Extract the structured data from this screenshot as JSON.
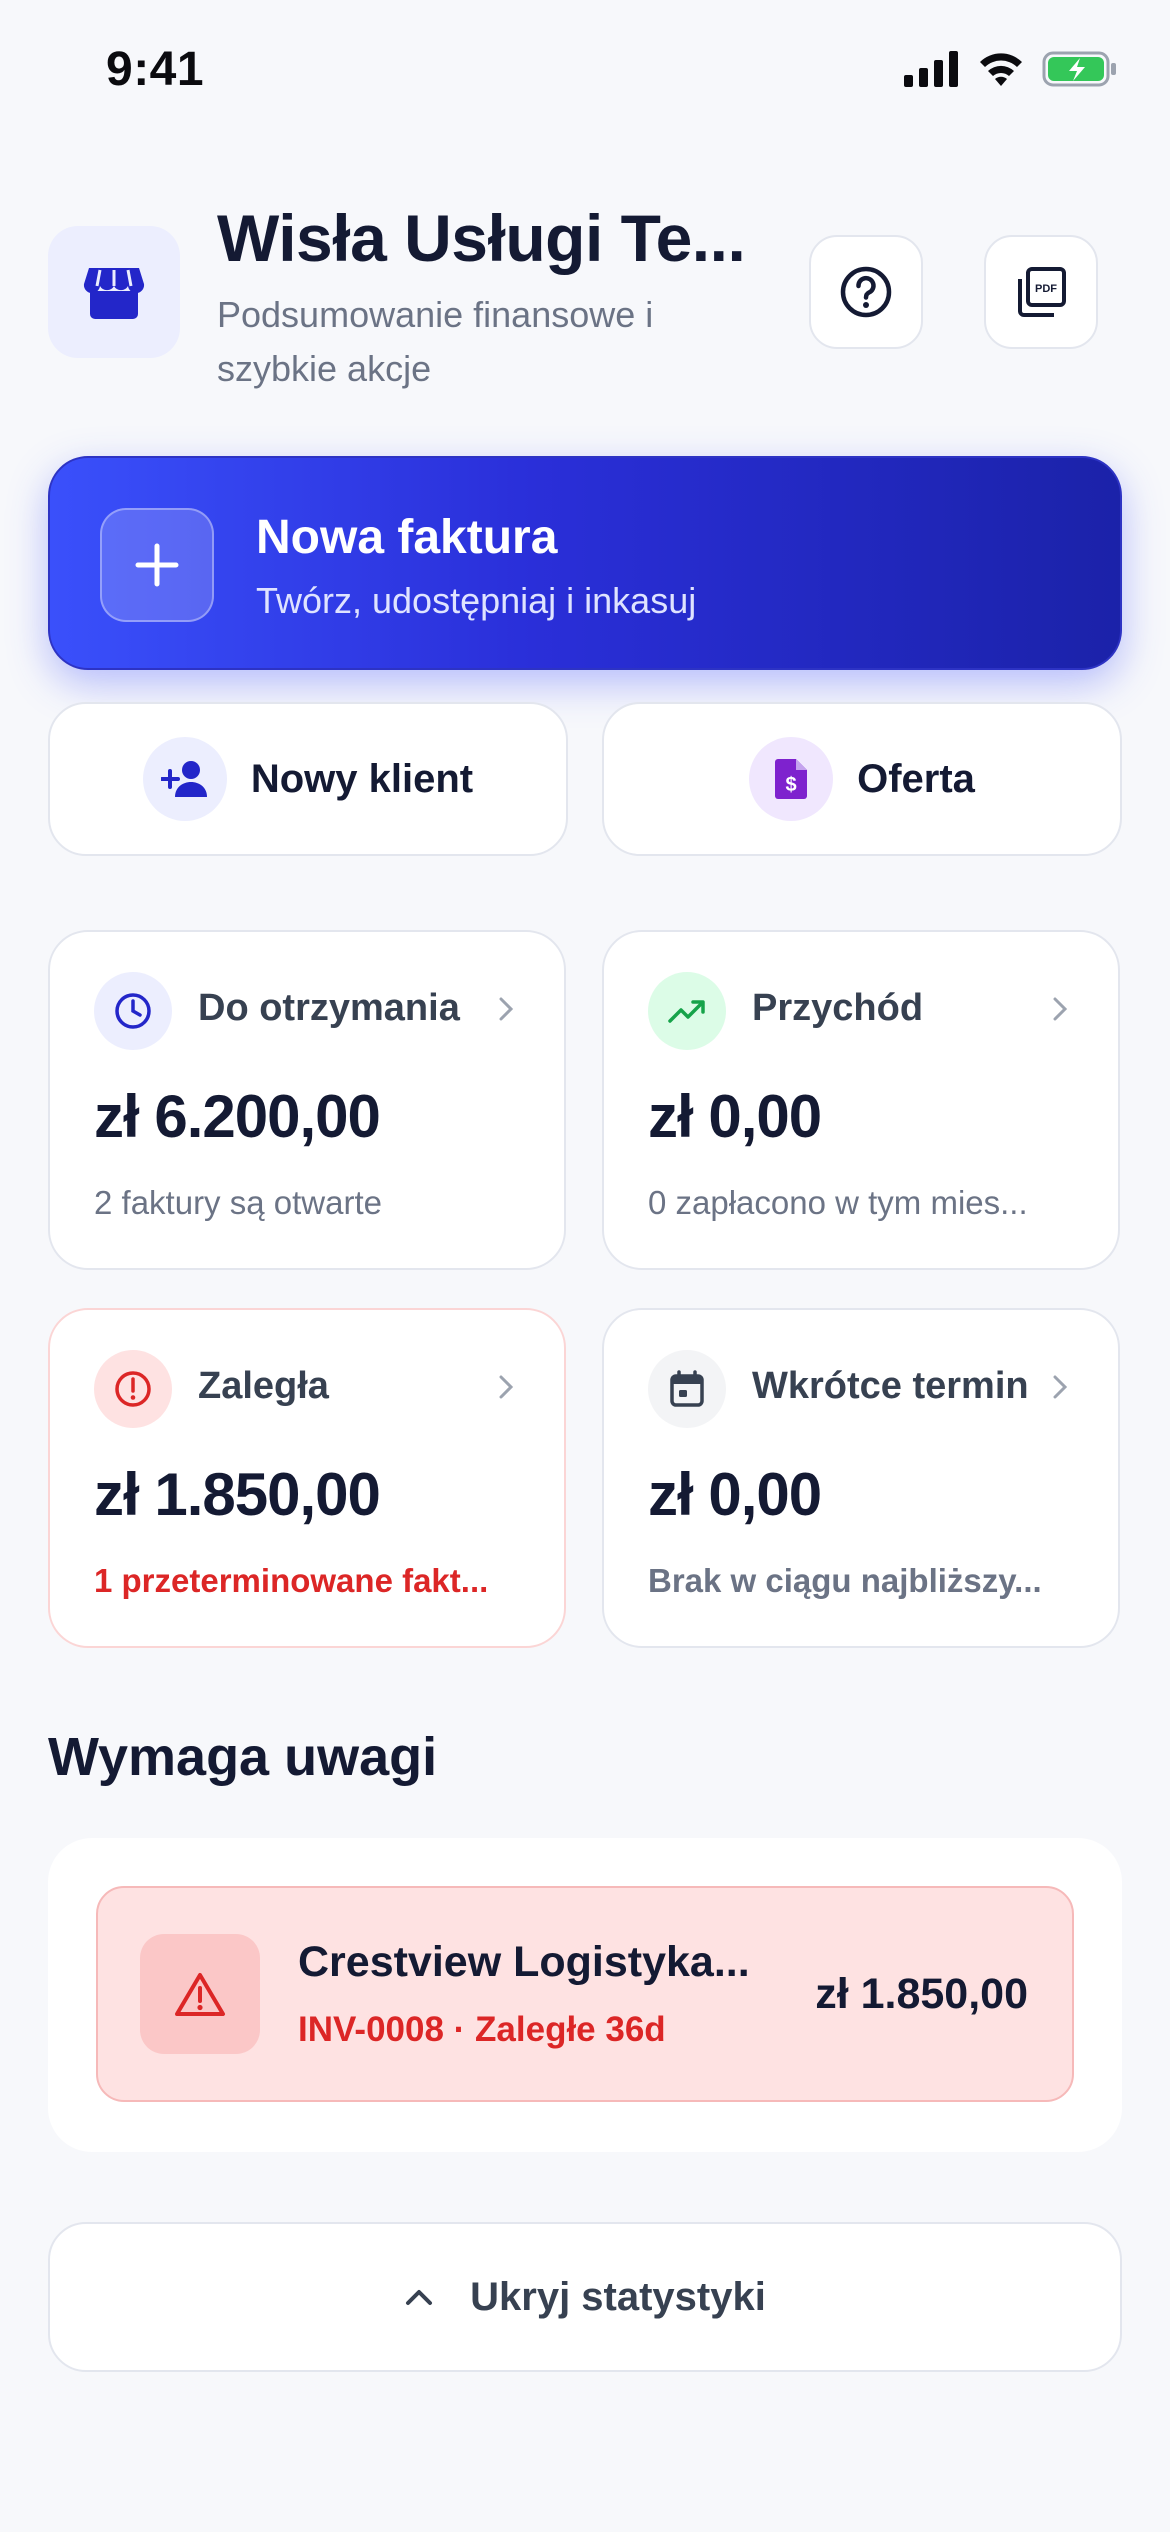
{
  "status_bar": {
    "time": "9:41"
  },
  "header": {
    "title": "Wisła Usługi Te...",
    "subtitle": "Podsumowanie finansowe i szybkie akcje"
  },
  "primary_action": {
    "title": "Nowa faktura",
    "subtitle": "Twórz, udostępniaj i inkasuj"
  },
  "secondary_actions": [
    {
      "label": "Nowy klient",
      "icon": "add-person-icon"
    },
    {
      "label": "Oferta",
      "icon": "quote-document-icon"
    }
  ],
  "stats": [
    {
      "label": "Do otrzymania",
      "value": "zł 6.200,00",
      "note": "2 faktury są otwarte",
      "icon": "clock-icon",
      "accent": "#3b4cfb"
    },
    {
      "label": "Przychód",
      "value": "zł 0,00",
      "note": "0 zapłacono w tym mies...",
      "icon": "trend-up-icon",
      "accent": "#16a34a"
    },
    {
      "label": "Zaległa",
      "value": "zł 1.850,00",
      "note": "1 przeterminowane fakt...",
      "icon": "alert-circle-icon",
      "accent": "#dc2626"
    },
    {
      "label": "Wkrótce termin",
      "value": "zł 0,00",
      "note": "Brak w ciągu najbliższy...",
      "icon": "calendar-icon",
      "accent": "#374151"
    }
  ],
  "attention": {
    "title": "Wymaga uwagi",
    "items": [
      {
        "name": "Crestview Logistyka...",
        "detail": "INV-0008 · Zaległe 36d",
        "amount": "zł 1.850,00",
        "icon": "warning-triangle-icon"
      }
    ]
  },
  "toggle": {
    "label": "Ukryj statystyki"
  },
  "colors": {
    "primary": "#3b4cfb",
    "primary_dark": "#1b22a9",
    "danger": "#dc2626",
    "danger_bg": "#fee2e2",
    "success": "#16a34a",
    "text": "#141a33",
    "muted": "#6b7385",
    "background": "#f7f8fb"
  }
}
